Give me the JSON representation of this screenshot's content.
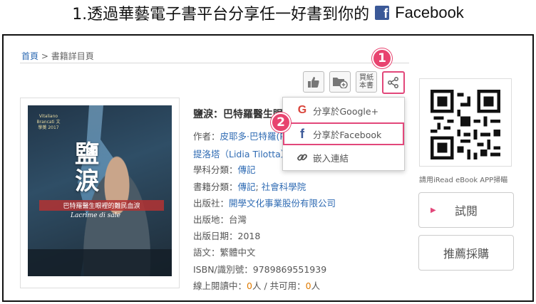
{
  "heading": {
    "text": "1.透過華藝電子書平台分享任一好書到你的",
    "brand": "Facebook",
    "fb_glyph": "f"
  },
  "breadcrumb": {
    "home": "首頁",
    "separator": ">",
    "current": "書籍詳目頁"
  },
  "toolbar": {
    "like_icon": "thumbs-up-icon",
    "folder_icon": "folder-add-icon",
    "print_label_1": "買紙",
    "print_label_2": "本書",
    "share_icon": "share-icon"
  },
  "badges": {
    "one": "1",
    "two": "2"
  },
  "cover": {
    "title_1": "鹽",
    "title_2": "淚",
    "subtitle": "巴特羅醫生眼裡的難民血淚",
    "english": "Lacrime di sale",
    "award": "Vitaliano Brancati 文學獎 2017"
  },
  "book": {
    "title": "鹽淚：巴特羅醫生眼裡的難民血淚",
    "author_label": "作者：",
    "author": "皮耶多·巴特羅(Pietro Bartolo)",
    "author2": "提洛塔（Lidia Tilotta）",
    "subject_label": "學科分類：",
    "subject": "傳記",
    "category_label": "書籍分類：",
    "category_1": "傳記",
    "category_sep": "; ",
    "category_2": "社會科學院",
    "publisher_label": "出版社：",
    "publisher": "開學文化事業股份有限公司",
    "place_label": "出版地：",
    "place": "台灣",
    "date_label": "出版日期：",
    "date": "2018",
    "language_label": "語文：",
    "language": "繁體中文",
    "isbn_label": "ISBN/識別號：",
    "isbn": "9789869551939",
    "reading_label": "線上閱讀中：",
    "reading_count": "0",
    "reading_unit": "人 / 共可用：",
    "available_count": "0",
    "available_unit": "人"
  },
  "share_menu": {
    "google": "分享於Google+",
    "facebook": "分享於Facebook",
    "embed": "嵌入連結"
  },
  "qr": {
    "caption": "請用iRead eBook APP掃瞄"
  },
  "buttons": {
    "trial": "試閱",
    "recommend": "推薦採購"
  },
  "colors": {
    "accent_pink": "#e2477a",
    "link_blue": "#2f6bb3",
    "facebook_blue": "#3b5998",
    "google_red": "#d9443a"
  }
}
